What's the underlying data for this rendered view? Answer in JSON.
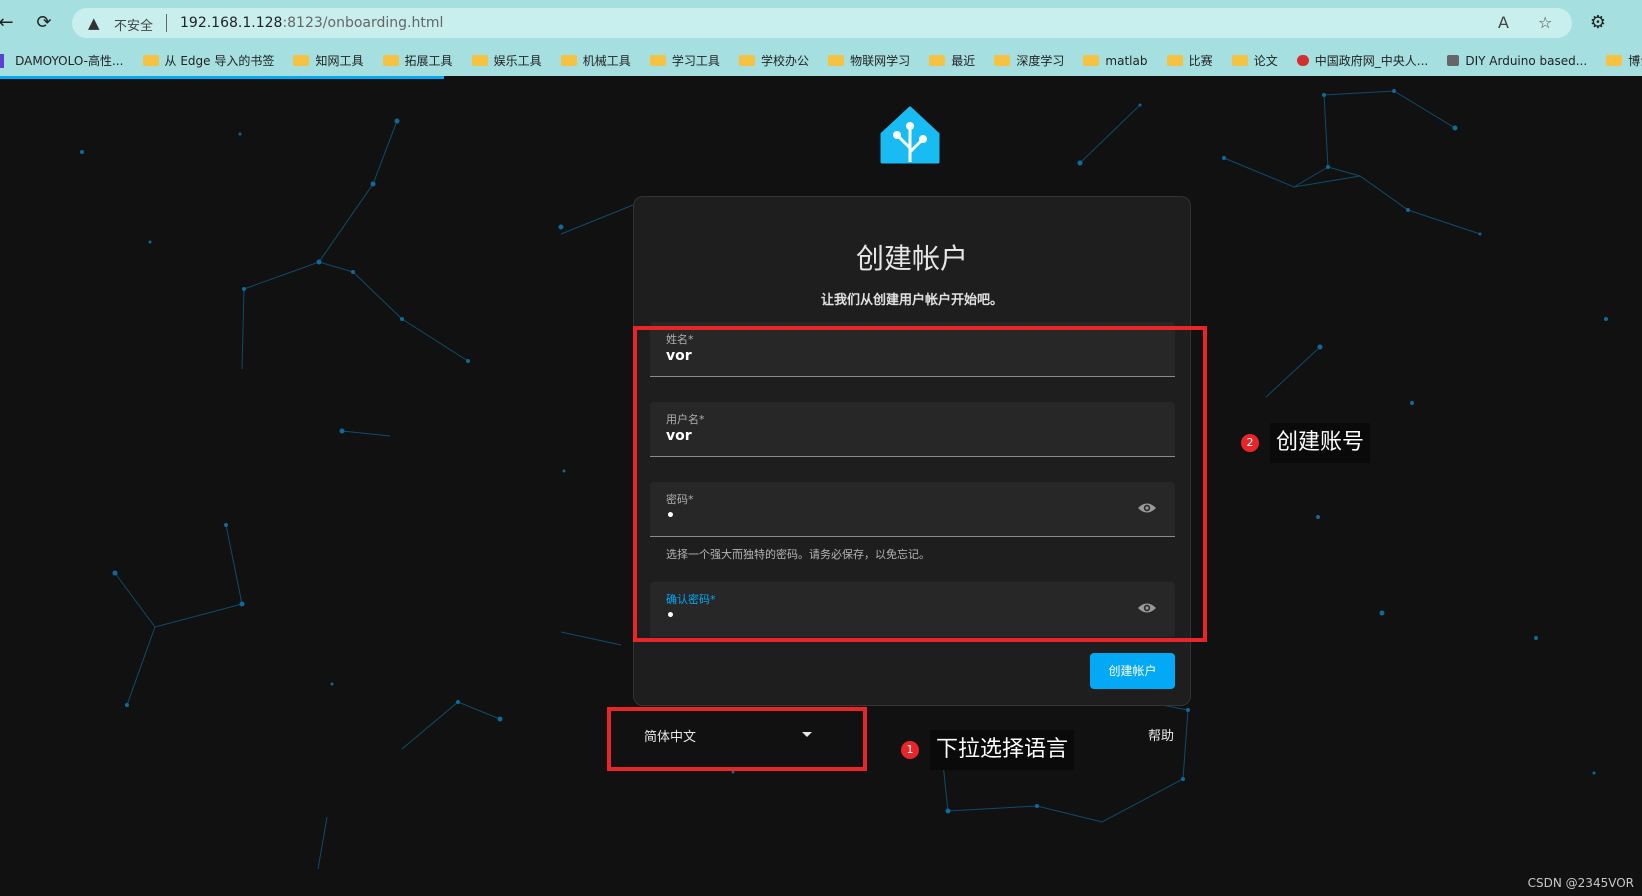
{
  "browser": {
    "insecure_label": "不安全",
    "url_host": "192.168.1.128",
    "url_rest": ":8123/onboarding.html",
    "bookmarks": [
      {
        "label": "DAMOYOLO-高性..."
      },
      {
        "label": "从 Edge 导入的书签"
      },
      {
        "label": "知网工具"
      },
      {
        "label": "拓展工具"
      },
      {
        "label": "娱乐工具"
      },
      {
        "label": "机械工具"
      },
      {
        "label": "学习工具"
      },
      {
        "label": "学校办公"
      },
      {
        "label": "物联网学习"
      },
      {
        "label": "最近"
      },
      {
        "label": "深度学习"
      },
      {
        "label": "matlab"
      },
      {
        "label": "比赛"
      },
      {
        "label": "论文"
      },
      {
        "label": "中国政府网_中央人..."
      },
      {
        "label": "DIY Arduino based..."
      },
      {
        "label": "博士"
      }
    ]
  },
  "card": {
    "title": "创建帐户",
    "subtitle": "让我们从创建用户帐户开始吧。",
    "fields": {
      "name": {
        "label": "姓名*",
        "value": "vor"
      },
      "username": {
        "label": "用户名*",
        "value": "vor"
      },
      "password": {
        "label": "密码*",
        "value": "•",
        "helper": "选择一个强大而独特的密码。请务必保存，以免忘记。"
      },
      "confirm": {
        "label": "确认密码*",
        "value": "•"
      }
    },
    "create_button": "创建帐户"
  },
  "footer": {
    "language": "简体中文",
    "help": "帮助"
  },
  "annotations": {
    "callout1_num": "1",
    "callout1_text": "下拉选择语言",
    "callout2_num": "2",
    "callout2_text": "创建账号",
    "highlight_color": "#e8262a"
  },
  "watermark": "CSDN @2345VOR",
  "colors": {
    "accent": "#03a9f4",
    "background": "#111111",
    "card": "#1e1e1e"
  }
}
